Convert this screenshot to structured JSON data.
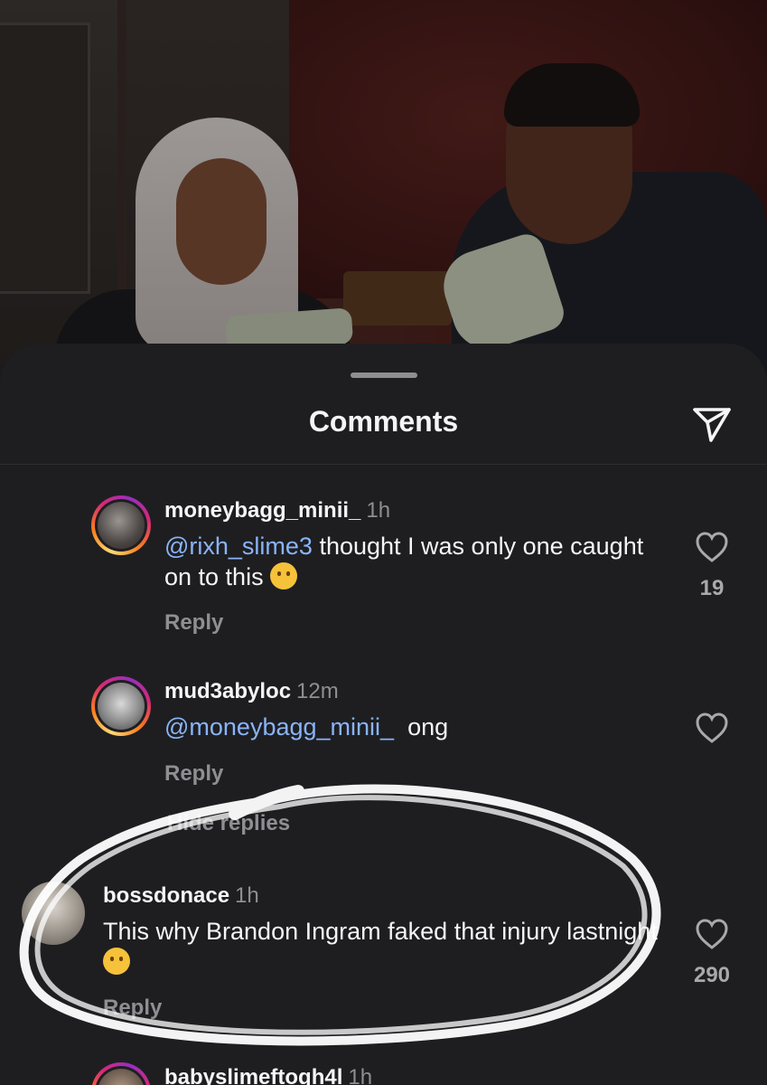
{
  "sheet": {
    "title": "Comments",
    "share_icon": "paper-plane-icon"
  },
  "comments": [
    {
      "username": "moneybagg_minii_",
      "time": "1h",
      "mention": "@rixh_slime3",
      "text": " thought I was only one caught on to this ",
      "emoji": "thinking-face",
      "reply_label": "Reply",
      "likes": "19"
    },
    {
      "username": "mud3abyloc",
      "time": "12m",
      "mention": "@moneybagg_minii_",
      "text": "  ong",
      "reply_label": "Reply",
      "hide_replies_label": "Hide replies"
    },
    {
      "username": "bossdonace",
      "time": "1h",
      "text": "This why Brandon Ingram faked that injury lastnight",
      "emoji": "face-with-tears-of-joy",
      "reply_label": "Reply",
      "likes": "290"
    },
    {
      "username": "babyslimeftogh4l",
      "time": "1h"
    }
  ],
  "colors": {
    "sheet_bg": "#1e1e21",
    "mention": "#8ab4f8",
    "muted": "#8e8e93",
    "scribble": "#ffffff"
  }
}
